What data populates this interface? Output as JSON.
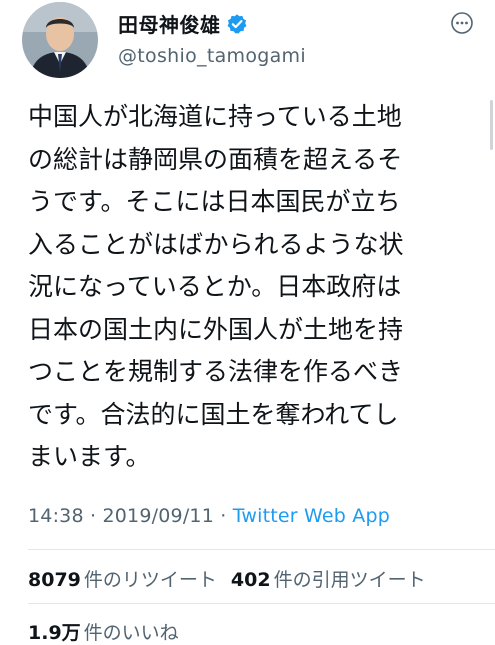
{
  "profile": {
    "display_name": "田母神俊雄",
    "handle": "@toshio_tamogami",
    "verified": true,
    "avatar_icon": "person-avatar-icon",
    "verified_icon": "verified-badge-icon",
    "more_icon": "more-options-icon"
  },
  "tweet": {
    "text": "中国人が北海道に持っている土地\nの総計は静岡県の面積を超えるそ\nうです。そこには日本国民が立ち\n入ることがはばかられるような状\n況になっているとか。日本政府は\n日本の国土内に外国人が土地を持\nつことを規制する法律を作るべき\nです。合法的に国土を奪われてし\nまいます。"
  },
  "meta": {
    "time": "14:38",
    "separator1": " · ",
    "date": "2019/09/11",
    "separator2": " · ",
    "source": "Twitter Web App"
  },
  "stats": {
    "retweets_count": "8079",
    "retweets_label": "件のリツイート",
    "quotes_count": "402",
    "quotes_label": "件の引用ツイート",
    "likes_count": "1.9万",
    "likes_label": "件のいいね"
  },
  "colors": {
    "accent": "#1d9bf0",
    "secondary_text": "#536471",
    "divider": "#e1e8ed"
  }
}
